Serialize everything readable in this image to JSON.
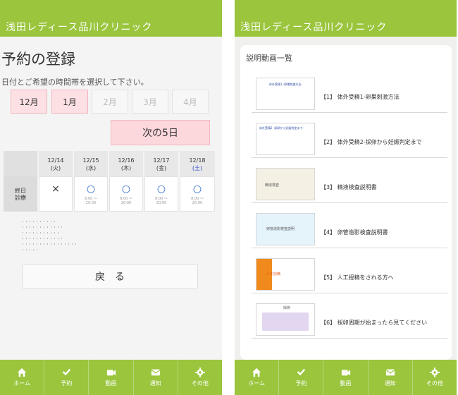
{
  "app_title": "浅田レディース品川クリニック",
  "reservation": {
    "page_title": "予約の登録",
    "instruction": "日付とご希望の時間帯を選択して下さい。",
    "months": [
      {
        "label": "12月",
        "active": true
      },
      {
        "label": "1月",
        "active": true
      },
      {
        "label": "2月",
        "active": false
      },
      {
        "label": "3月",
        "active": false
      },
      {
        "label": "4月",
        "active": false
      }
    ],
    "next_label": "次の5日",
    "row_label_1": "終日",
    "row_label_2": "診療",
    "days": [
      {
        "date": "12/14",
        "weekday": "(火)",
        "mark": "×",
        "time1": "",
        "time2": ""
      },
      {
        "date": "12/15",
        "weekday": "(水)",
        "mark": "○",
        "time1": "8:00 ～",
        "time2": "20:00"
      },
      {
        "date": "12/16",
        "weekday": "(木)",
        "mark": "○",
        "time1": "8:00 ～",
        "time2": "20:00"
      },
      {
        "date": "12/17",
        "weekday": "(金)",
        "mark": "○",
        "time1": "8:00 ～",
        "time2": "20:00"
      },
      {
        "date": "12/18",
        "weekday": "(土)",
        "mark": "○",
        "time1": "8:00 ～",
        "time2": "20:00"
      }
    ],
    "back_label": "戻　る"
  },
  "videos": {
    "panel_title": "説明動画一覧",
    "items": [
      {
        "title": "【1】 体外受精1-卵巣刺激方法",
        "thumb_text": "体外受精1 -卵巣刺激方法-",
        "style": "white"
      },
      {
        "title": "【2】 体外受精2-採卵から妊娠判定まで",
        "thumb_text": "体外受精2 -採卵から妊娠判定まで-",
        "style": "white"
      },
      {
        "title": "【3】 精液検査説明書",
        "thumb_text": "精液検査",
        "style": "cream"
      },
      {
        "title": "【4】 卵管造影検査説明書",
        "thumb_text": "卵管造影検査説明",
        "style": "lightblue"
      },
      {
        "title": "【5】 人工授精をされる方へ",
        "thumb_text": "人工授精",
        "style": "orange"
      },
      {
        "title": "【6】 採卵周期が始まったら見てください",
        "thumb_text": "採卵",
        "style": "white"
      }
    ]
  },
  "tabs": [
    {
      "label": "ホーム",
      "icon": "home-icon"
    },
    {
      "label": "予約",
      "icon": "check-icon"
    },
    {
      "label": "動画",
      "icon": "video-icon"
    },
    {
      "label": "通知",
      "icon": "mail-icon"
    },
    {
      "label": "その他",
      "icon": "gear-icon"
    }
  ],
  "colors": {
    "brand_green": "#9ac53d",
    "active_pink": "#fde0e4",
    "available_blue": "#2a6ad1"
  }
}
